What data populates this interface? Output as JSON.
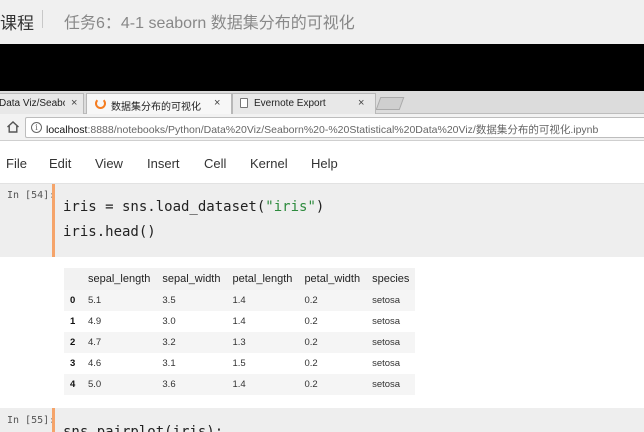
{
  "course": {
    "label": "课程",
    "title": "任务6：4-1 seaborn 数据集分布的可视化"
  },
  "browser": {
    "tabs": [
      {
        "label": "Data Viz/Seaborn",
        "close": "×",
        "icon": "notebook-icon",
        "active": false
      },
      {
        "label": "数据集分布的可视化",
        "close": "×",
        "icon": "spinner-icon",
        "active": true
      },
      {
        "label": "Evernote Export",
        "close": "×",
        "icon": "document-icon",
        "active": false
      }
    ],
    "url_host": "localhost",
    "url_path": ":8888/notebooks/Python/Data%20Viz/Seaborn%20-%20Statistical%20Data%20Viz/数据集分布的可视化.ipynb"
  },
  "menu": [
    "File",
    "Edit",
    "View",
    "Insert",
    "Cell",
    "Kernel",
    "Help"
  ],
  "cells": [
    {
      "prompt": "In [54]:",
      "lines": [
        {
          "pre": "iris = sns.load_dataset(",
          "str": "\"iris\"",
          "post": ")"
        },
        {
          "pre": "iris.head()",
          "str": "",
          "post": ""
        }
      ]
    },
    {
      "prompt": "In [55]:",
      "lines": [
        {
          "pre": "sns.pairplot(iris);",
          "str": "",
          "post": ""
        }
      ]
    }
  ],
  "dataframe": {
    "columns": [
      "",
      "sepal_length",
      "sepal_width",
      "petal_length",
      "petal_width",
      "species"
    ],
    "rows": [
      [
        "0",
        "5.1",
        "3.5",
        "1.4",
        "0.2",
        "setosa"
      ],
      [
        "1",
        "4.9",
        "3.0",
        "1.4",
        "0.2",
        "setosa"
      ],
      [
        "2",
        "4.7",
        "3.2",
        "1.3",
        "0.2",
        "setosa"
      ],
      [
        "3",
        "4.6",
        "3.1",
        "1.5",
        "0.2",
        "setosa"
      ],
      [
        "4",
        "5.0",
        "3.6",
        "1.4",
        "0.2",
        "setosa"
      ]
    ]
  },
  "colors": {
    "cell_edge": "#f5a46a",
    "string_literal": "#2e8b3e",
    "spinner": "#f57c1f"
  }
}
